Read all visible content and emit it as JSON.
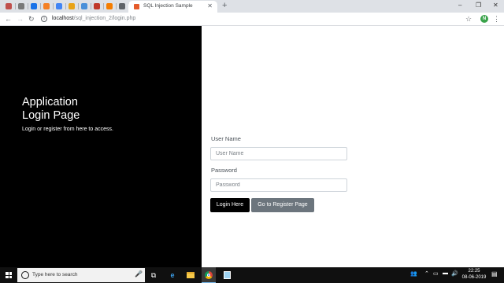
{
  "browser": {
    "active_tab": {
      "title": "SQL Injection Sample"
    },
    "new_tab": "+",
    "window_controls": {
      "minimize": "–",
      "restore": "❐",
      "close": "✕"
    },
    "nav": {
      "back": "←",
      "forward": "→",
      "reload": "↻",
      "star": "☆",
      "menu": "⋮"
    },
    "address": {
      "host": "localhost",
      "path": "/sql_injection_2/login.php"
    },
    "profile_initial": "N",
    "pinned_icons": [
      {
        "name": "person-icon",
        "color": "#c0504d"
      },
      {
        "name": "globe-icon",
        "color": "#7a7a7a"
      },
      {
        "name": "sync-icon",
        "color": "#1a73e8"
      },
      {
        "name": "cloud-icon",
        "color": "#f48024"
      },
      {
        "name": "apps-grid-icon",
        "color": "#4285f4"
      },
      {
        "name": "bookmark-icon",
        "color": "#e8a317"
      },
      {
        "name": "doc-icon",
        "color": "#4a90d9"
      },
      {
        "name": "book-icon",
        "color": "#c0392b"
      },
      {
        "name": "blogger-icon",
        "color": "#f57d00"
      },
      {
        "name": "calendar-icon",
        "color": "#5f6368"
      }
    ]
  },
  "page": {
    "heading_line1": "Application",
    "heading_line2": "Login Page",
    "subtitle": "Login or register from here to access.",
    "username_label": "User Name",
    "username_placeholder": "User Name",
    "password_label": "Password",
    "password_placeholder": "Password",
    "login_button": "Login Here",
    "register_button": "Go to Register Page"
  },
  "taskbar": {
    "search_placeholder": "Type here to search",
    "time": "22:25",
    "date": "08-06-2019",
    "apps": [
      {
        "name": "task-view-icon"
      },
      {
        "name": "edge-icon"
      },
      {
        "name": "file-explorer-icon"
      },
      {
        "name": "chrome-icon",
        "active": true
      },
      {
        "name": "notepad-icon"
      }
    ]
  },
  "colors": {
    "left_panel": "#000000",
    "login_button": "#000000",
    "register_button": "#6c757d",
    "taskbar": "#101010"
  }
}
